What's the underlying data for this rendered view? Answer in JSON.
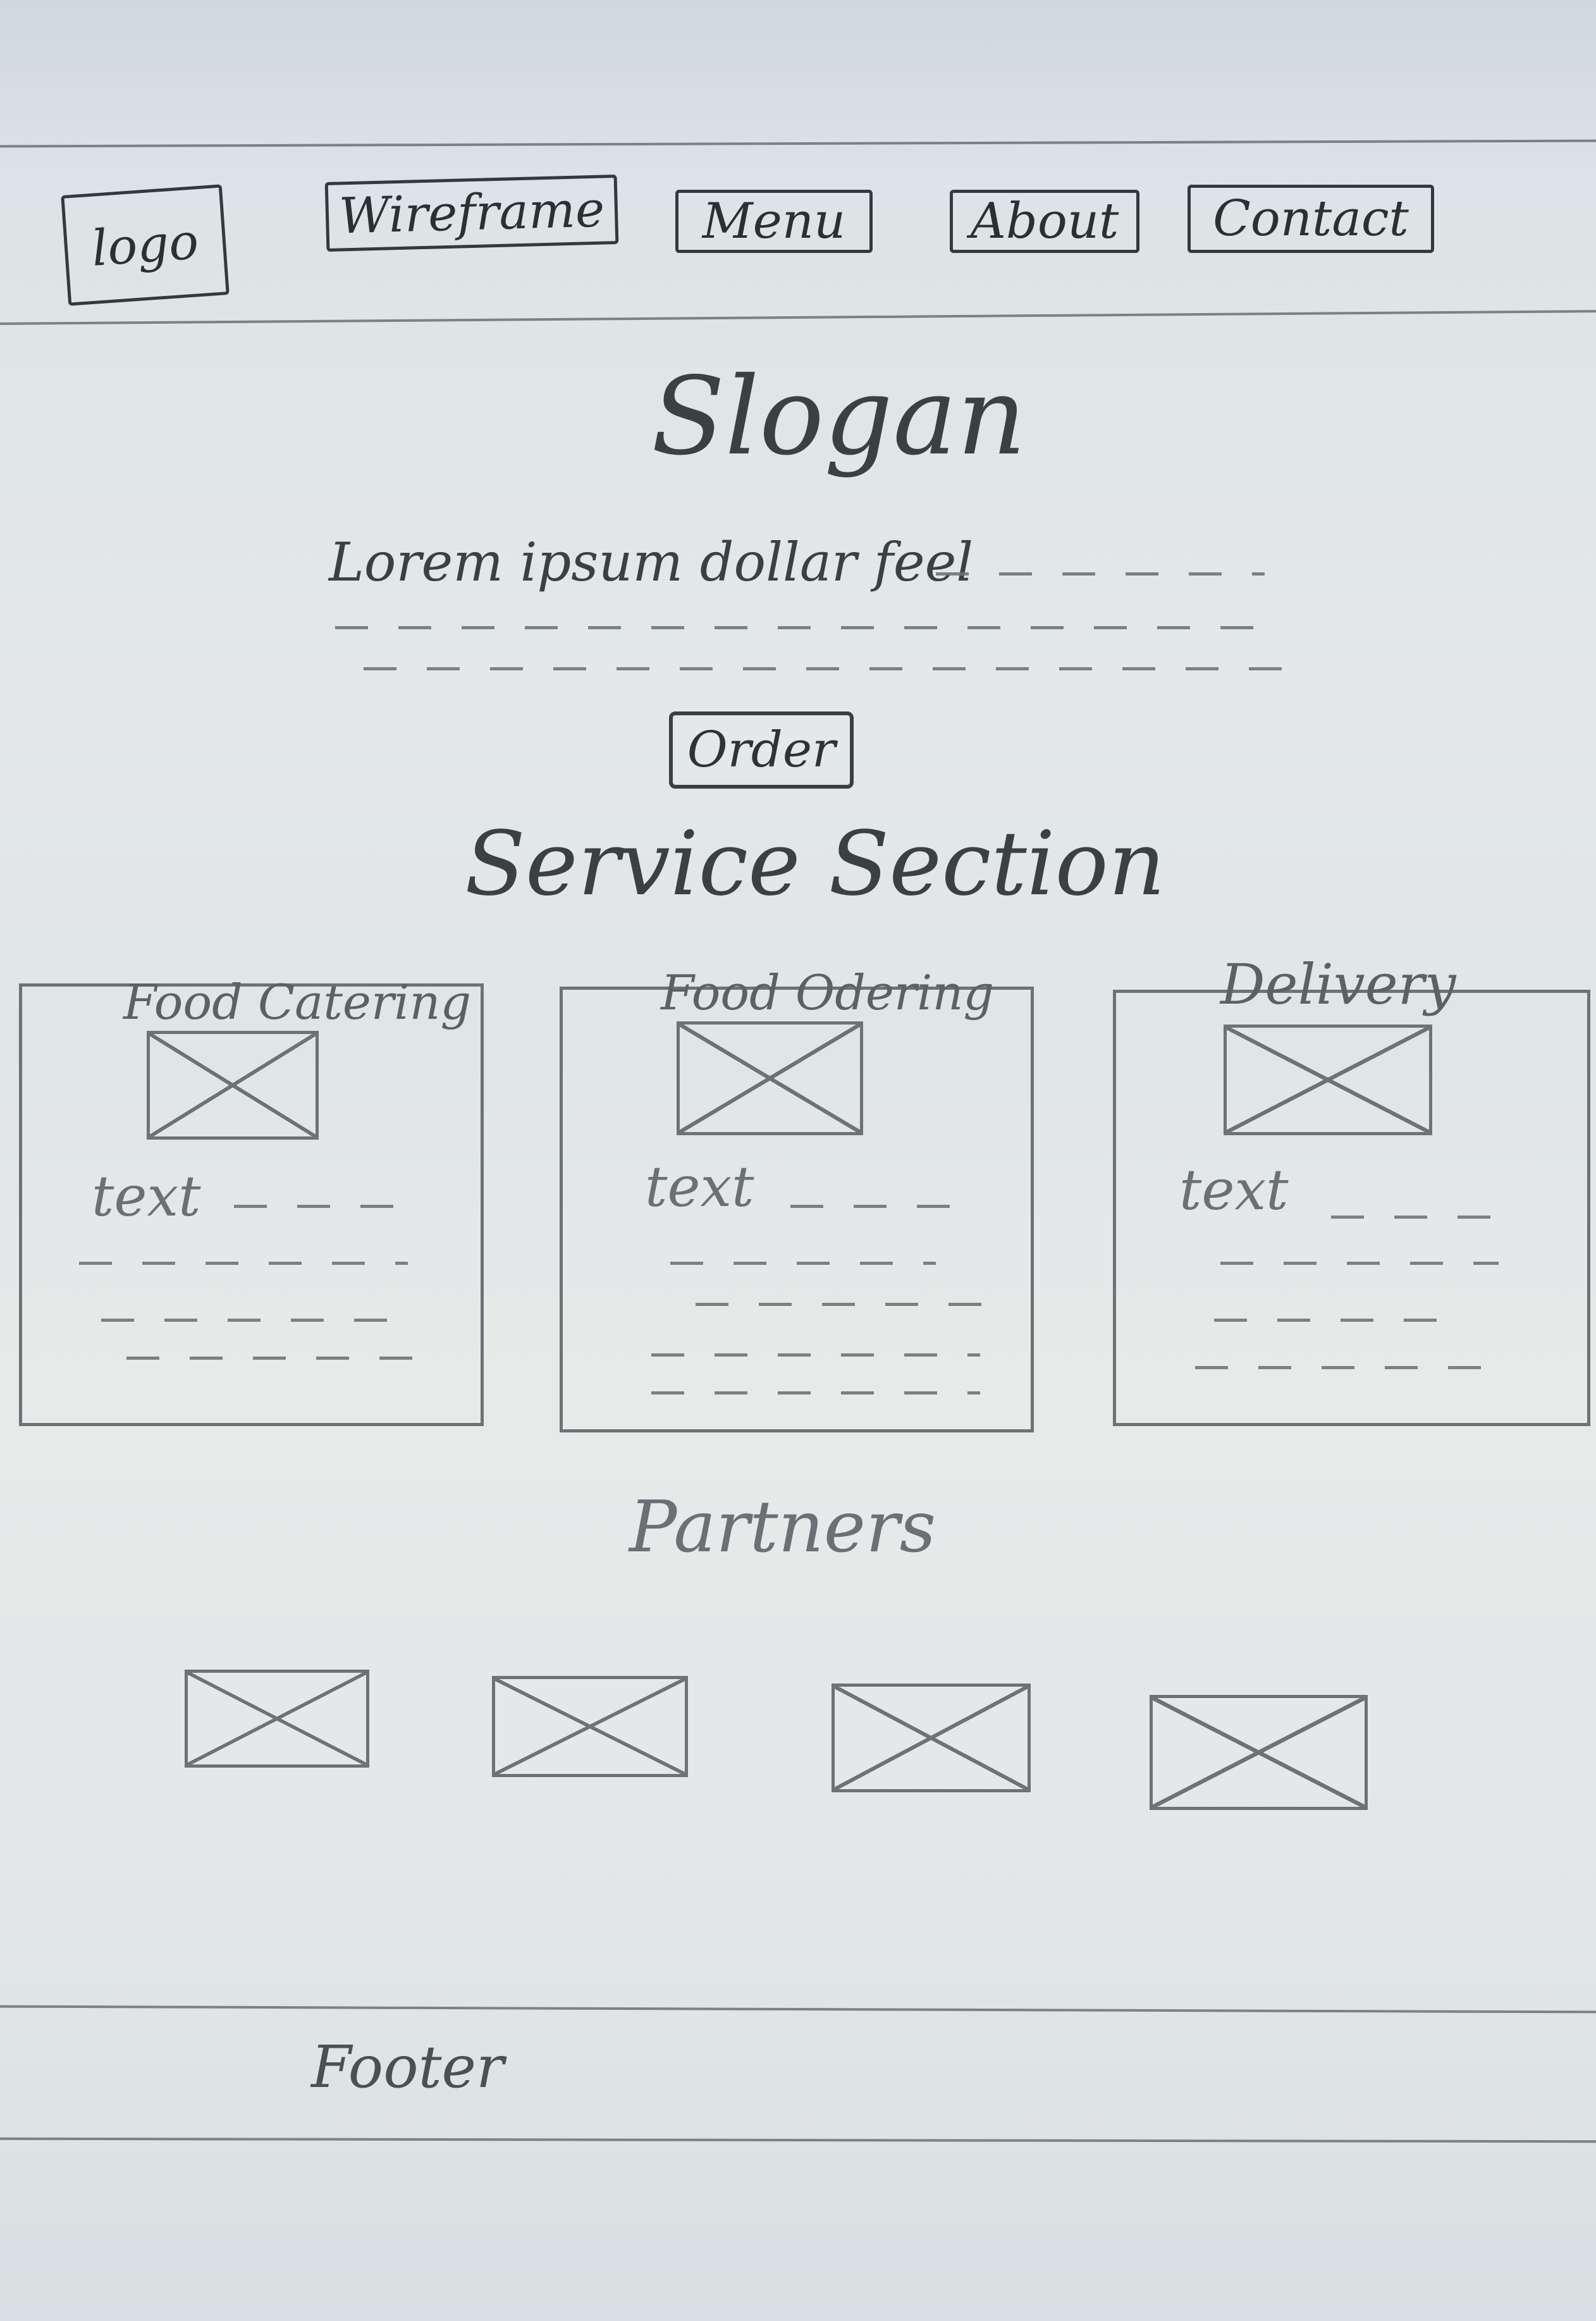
{
  "header": {
    "logo_label": "logo",
    "nav": [
      "Wireframe",
      "Menu",
      "About",
      "Contact"
    ]
  },
  "hero": {
    "slogan": "Slogan",
    "lorem": "Lorem ipsum dollar feel",
    "order_label": "Order"
  },
  "services": {
    "title": "Service Section",
    "cards": [
      {
        "title": "Food Catering",
        "text": "text"
      },
      {
        "title": "Food Odering",
        "text": "text"
      },
      {
        "title": "Delivery",
        "text": "text"
      }
    ]
  },
  "partners": {
    "title": "Partners"
  },
  "footer": {
    "label": "Footer"
  }
}
